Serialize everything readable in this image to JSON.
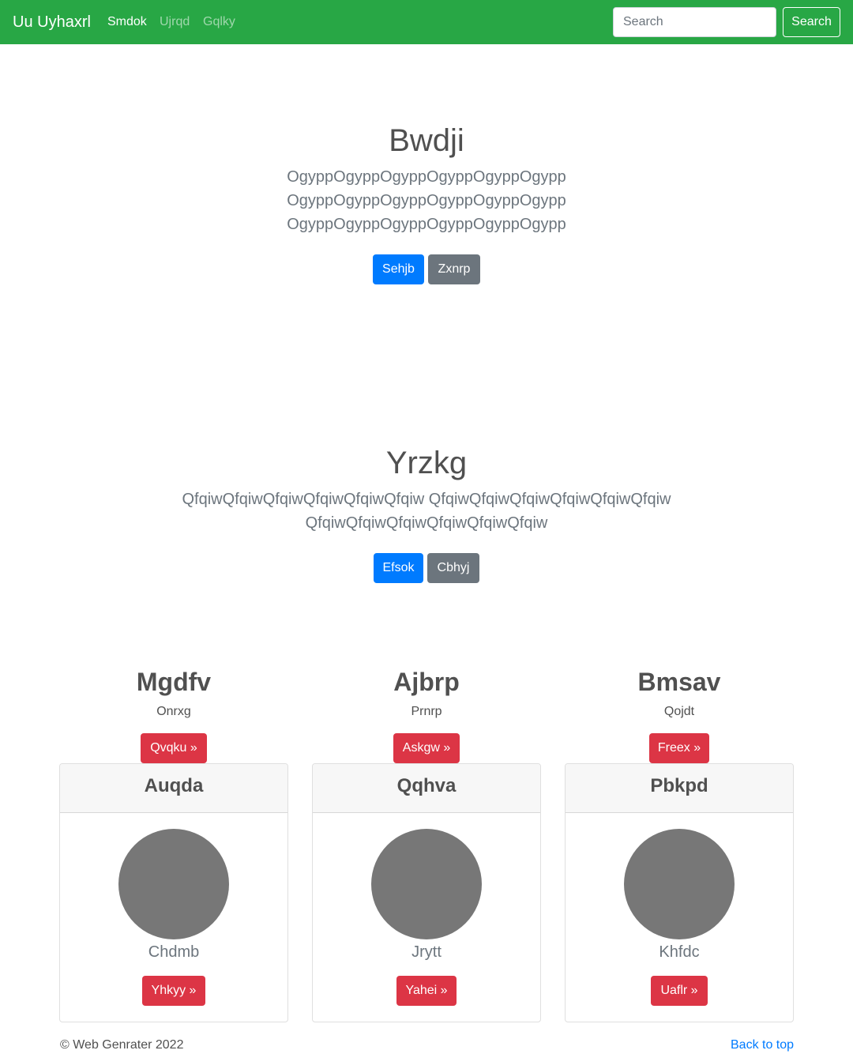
{
  "navbar": {
    "brand": "Uu Uyhaxrl",
    "links": [
      "Smdok",
      "Ujrqd",
      "Gqlky"
    ],
    "search_placeholder": "Search",
    "search_button": "Search"
  },
  "hero1": {
    "title": "Bwdji",
    "lines": [
      "OgyppOgyppOgyppOgyppOgyppOgypp",
      "OgyppOgyppOgyppOgyppOgyppOgypp",
      "OgyppOgyppOgyppOgyppOgyppOgypp"
    ],
    "primary_button": "Sehjb",
    "secondary_button": "Zxnrp"
  },
  "hero2": {
    "title": "Yrzkg",
    "lines": [
      "QfqiwQfqiwQfqiwQfqiwQfqiwQfqiw QfqiwQfqiwQfqiwQfqiwQfqiwQfqiw",
      "QfqiwQfqiwQfqiwQfqiwQfqiwQfqiw"
    ],
    "primary_button": "Efsok",
    "secondary_button": "Cbhyj"
  },
  "features": [
    {
      "title": "Mgdfv",
      "text": "Onrxg",
      "button": "Qvqku »"
    },
    {
      "title": "Ajbrp",
      "text": "Prnrp",
      "button": "Askgw »"
    },
    {
      "title": "Bmsav",
      "text": "Qojdt",
      "button": "Freex »"
    }
  ],
  "cards": [
    {
      "header": "Auqda",
      "name": "Chdmb",
      "button": "Yhkyy »"
    },
    {
      "header": "Qqhva",
      "name": "Jrytt",
      "button": "Yahei »"
    },
    {
      "header": "Pbkpd",
      "name": "Khfdc",
      "button": "Uaflr »"
    }
  ],
  "footer": {
    "copyright": "© Web Genrater 2022",
    "back_to_top": "Back to top"
  },
  "colors": {
    "navbar": "#28a745",
    "primary": "#007bff",
    "secondary": "#6c757d",
    "danger": "#dc3545"
  }
}
